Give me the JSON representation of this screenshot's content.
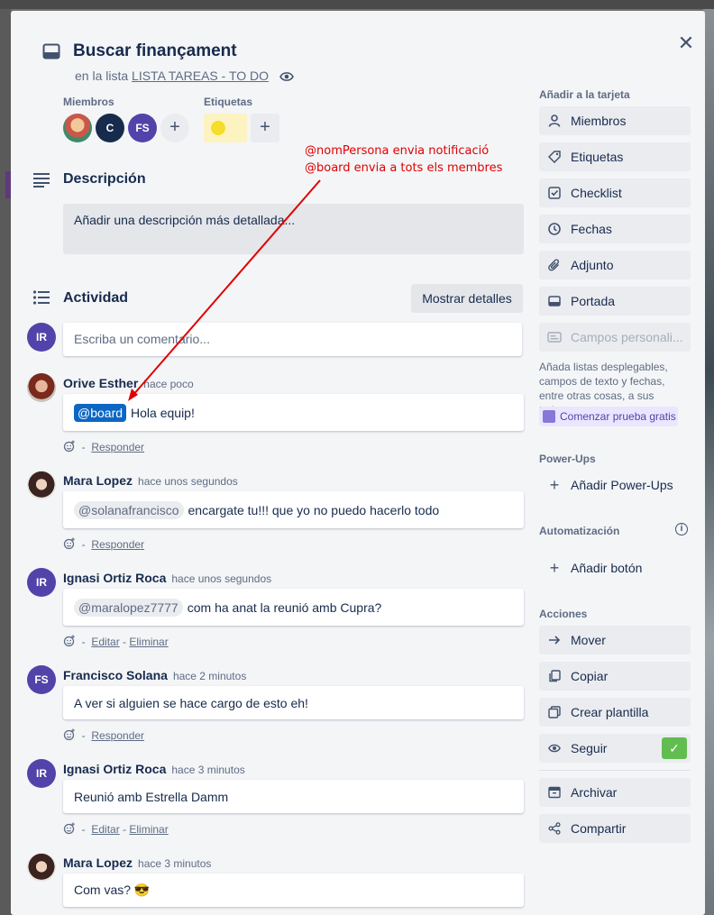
{
  "card": {
    "title": "Buscar finançament",
    "list_prefix": "en la lista",
    "list_name": "LISTA TAREAS - TO DO"
  },
  "members": {
    "label": "Miembros",
    "avatars": [
      {
        "initials": ""
      },
      {
        "initials": "C"
      },
      {
        "initials": "FS"
      }
    ]
  },
  "labels": {
    "label": "Etiquetas",
    "chip_color": "#f5dd29"
  },
  "description": {
    "heading": "Descripción",
    "placeholder": "Añadir una descripción más detallada..."
  },
  "activity": {
    "heading": "Actividad",
    "details_button": "Mostrar detalles",
    "current_user_initials": "IR",
    "comment_placeholder": "Escriba un comentario...",
    "items": [
      {
        "author": "Orive Esther",
        "time": "hace poco",
        "mention": "@board",
        "text": "Hola equip!",
        "actions": [
          "Responder"
        ]
      },
      {
        "author": "Mara Lopez",
        "time": "hace unos segundos",
        "mention": "@solanafrancisco",
        "text": "encargate tu!!! que yo no puedo hacerlo todo",
        "actions": [
          "Responder"
        ]
      },
      {
        "author": "Ignasi Ortiz Roca",
        "initials": "IR",
        "time": "hace unos segundos",
        "mention": "@maralopez7777",
        "text": "com ha anat la reunió amb Cupra?",
        "actions": [
          "Editar",
          "Eliminar"
        ]
      },
      {
        "author": "Francisco Solana",
        "initials": "FS",
        "time": "hace 2 minutos",
        "text": "A ver si alguien se hace cargo de esto eh!",
        "actions": [
          "Responder"
        ]
      },
      {
        "author": "Ignasi Ortiz Roca",
        "initials": "IR",
        "time": "hace 3 minutos",
        "text": "Reunió amb Estrella Damm",
        "actions": [
          "Editar",
          "Eliminar"
        ]
      },
      {
        "author": "Mara Lopez",
        "time": "hace 3 minutos",
        "text": "Com vas? 😎"
      }
    ]
  },
  "sidebar": {
    "add_to_card_label": "Añadir a la tarjeta",
    "add_buttons": [
      "Miembros",
      "Etiquetas",
      "Checklist",
      "Fechas",
      "Adjunto",
      "Portada",
      "Campos personali..."
    ],
    "custom_fields_desc": "Añada listas desplegables, campos de texto y fechas, entre otras cosas, a sus tarjetas.",
    "trial_button": "Comenzar prueba gratis",
    "powerups_label": "Power-Ups",
    "add_powerups": "Añadir Power-Ups",
    "automation_label": "Automatización",
    "add_button": "Añadir botón",
    "actions_label": "Acciones",
    "action_buttons": [
      "Mover",
      "Copiar",
      "Crear plantilla",
      "Seguir",
      "Archivar",
      "Compartir"
    ]
  },
  "annotation": {
    "line1": "@nomPersona envia notificació",
    "line2": "@board envia a tots els membres"
  },
  "colors": {
    "accent": "#0c66c4",
    "avatar_purple": "#5243aa",
    "annotation": "#e00000",
    "follow_check": "#61bd4f"
  }
}
